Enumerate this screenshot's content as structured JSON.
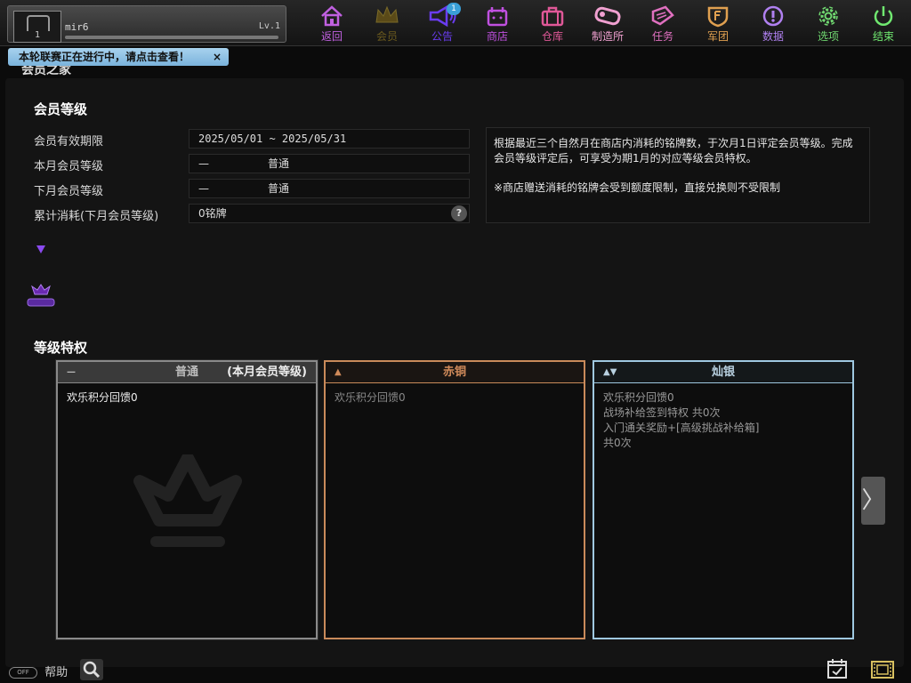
{
  "player": {
    "level_badge": "1",
    "name": "mir6",
    "level_text": "Lv.1"
  },
  "nav": [
    {
      "label": "返回",
      "icon": "home-icon",
      "color": "#c060e0"
    },
    {
      "label": "会员",
      "icon": "crown-icon",
      "color": "#6b5a1e"
    },
    {
      "label": "公告",
      "icon": "megaphone-icon",
      "color": "#6a3cf0",
      "badge": "1"
    },
    {
      "label": "商店",
      "icon": "shop-icon",
      "color": "#c050e0"
    },
    {
      "label": "仓库",
      "icon": "bag-icon",
      "color": "#e05898"
    },
    {
      "label": "制造所",
      "icon": "wrench-icon",
      "color": "#f0a0d0"
    },
    {
      "label": "任务",
      "icon": "quest-icon",
      "color": "#e070c0"
    },
    {
      "label": "军团",
      "icon": "legion-icon",
      "color": "#e0a050"
    },
    {
      "label": "数据",
      "icon": "info-icon",
      "color": "#b080f0"
    },
    {
      "label": "选项",
      "icon": "gear-icon",
      "color": "#70d870"
    },
    {
      "label": "结束",
      "icon": "power-icon",
      "color": "#70e870"
    }
  ],
  "banner": {
    "text": "本轮联赛正在进行中，请点击查看！",
    "close": "×"
  },
  "panel_title": "会员之家",
  "membership": {
    "section_title": "会员等级",
    "rows": [
      {
        "label": "会员有效期限",
        "value": "2025/05/01 ~ 2025/05/31"
      },
      {
        "label": "本月会员等级",
        "icon": "—",
        "value": "普通"
      },
      {
        "label": "下月会员等级",
        "icon": "—",
        "value": "普通"
      },
      {
        "label": "累计消耗(下月会员等级)",
        "value": "0铭牌",
        "help": "?"
      }
    ],
    "description": "根据最近三个自然月在商店内消耗的铭牌数，于次月1日评定会员等级。完成会员等级评定后，可享受为期1月的对应等级会员特权。",
    "note": "※商店赠送消耗的铭牌会受到额度限制，直接兑换则不受限制"
  },
  "privileges": {
    "section_title": "等级特权",
    "cards": [
      {
        "name": "普通",
        "icon": "—",
        "current_tag": "(本月会员等级)",
        "border": "#8a8a8a",
        "title_color": "#bbbbbb",
        "perks": [
          "欢乐积分回馈0"
        ]
      },
      {
        "name": "赤铜",
        "icon": "▲",
        "border": "#c98a5a",
        "title_color": "#d08a5a",
        "perks": [
          "欢乐积分回馈0"
        ]
      },
      {
        "name": "灿银",
        "icon": "▲▼",
        "border": "#9fc8e0",
        "title_color": "#b8d0e0",
        "perks": [
          "欢乐积分回馈0",
          "战场补给签到特权 共0次",
          "入门通关奖励+[高级挑战补给箱]",
          "共0次"
        ]
      }
    ],
    "next": "〉"
  },
  "footer": {
    "toggle": "OFF",
    "help_label": "帮助"
  }
}
